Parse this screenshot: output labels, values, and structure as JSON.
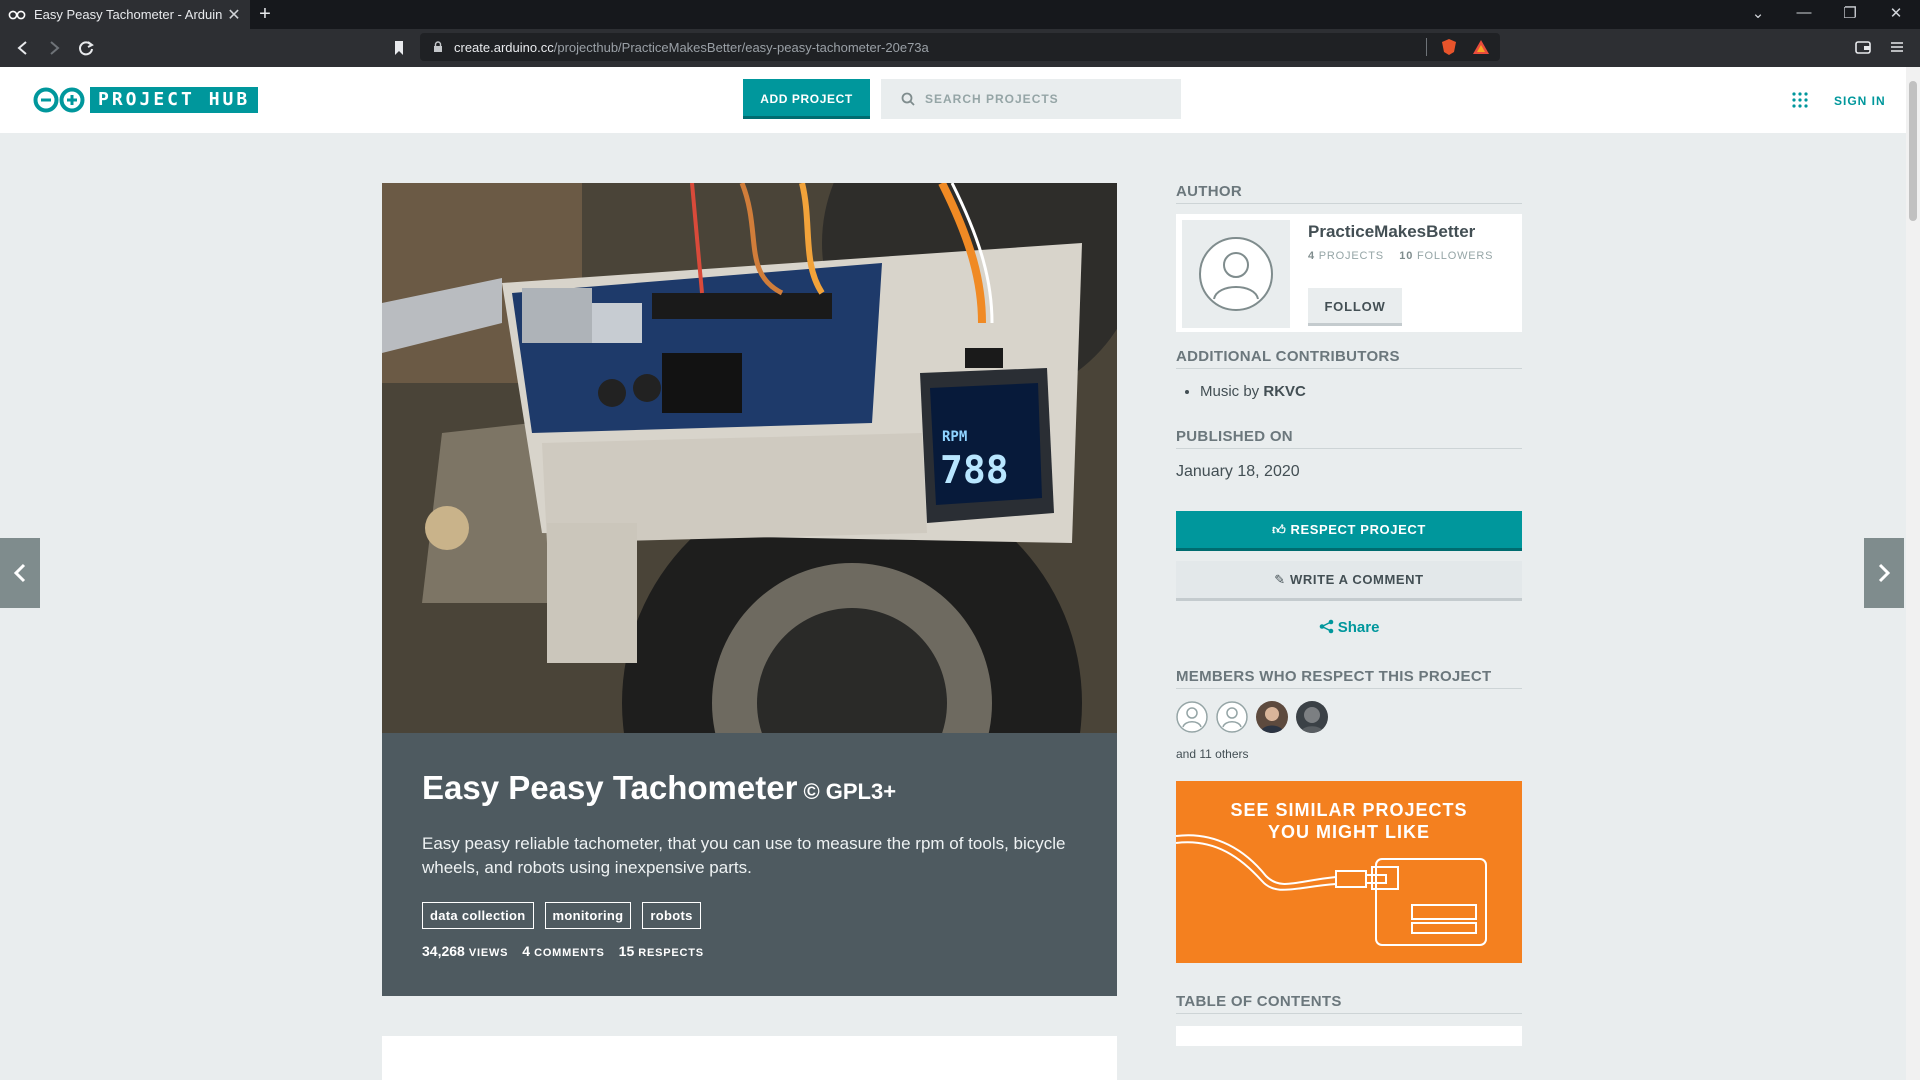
{
  "browser": {
    "tab_title": "Easy Peasy Tachometer - Arduino",
    "url_host": "create.arduino.cc",
    "url_path": "/projecthub/PracticeMakesBetter/easy-peasy-tachometer-20e73a"
  },
  "header": {
    "logo_text": "PROJECT HUB",
    "add_project": "ADD PROJECT",
    "search_placeholder": "SEARCH PROJECTS",
    "sign_in": "SIGN IN"
  },
  "project": {
    "title": "Easy Peasy Tachometer",
    "license": "© GPL3+",
    "description": "Easy peasy reliable tachometer, that you can use to measure the rpm of tools, bicycle wheels, and robots using inexpensive parts.",
    "tags": [
      "data collection",
      "monitoring",
      "robots"
    ],
    "stats": {
      "views": "34,268",
      "views_label": "VIEWS",
      "comments": "4",
      "comments_label": "COMMENTS",
      "respects": "15",
      "respects_label": "RESPECTS"
    },
    "image_display": {
      "label": "RPM",
      "value": "788"
    }
  },
  "sidebar": {
    "author_head": "AUTHOR",
    "author_name": "PracticeMakesBetter",
    "author_projects": "4",
    "author_projects_label": "PROJECTS",
    "author_followers": "10",
    "author_followers_label": "FOLLOWERS",
    "follow": "FOLLOW",
    "contrib_head": "ADDITIONAL CONTRIBUTORS",
    "contrib_prefix": "Music by",
    "contrib_name": "RKVC",
    "published_head": "PUBLISHED ON",
    "published_date": "January 18, 2020",
    "respect": "RESPECT PROJECT",
    "comment": "WRITE A COMMENT",
    "share": "Share",
    "members_head": "MEMBERS WHO RESPECT THIS PROJECT",
    "others": "and 11 others",
    "similar_line1": "SEE SIMILAR PROJECTS",
    "similar_line2": "YOU MIGHT LIKE",
    "toc_head": "TABLE OF CONTENTS"
  },
  "colors": {
    "brand": "#00979c",
    "info_bg": "#4e5a60",
    "similar_bg": "#f4801f"
  }
}
